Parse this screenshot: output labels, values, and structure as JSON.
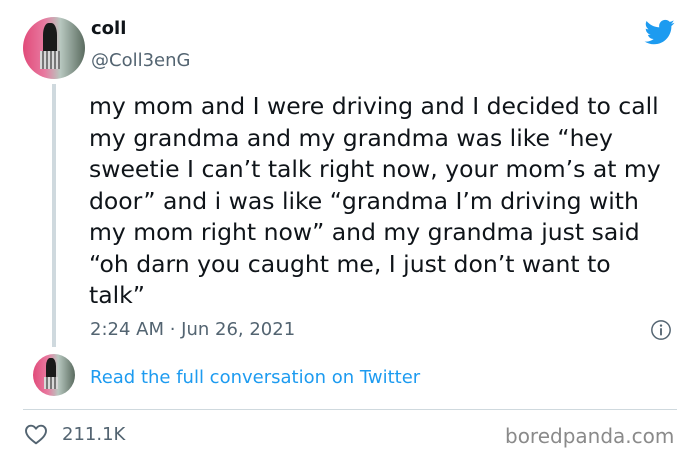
{
  "tweet": {
    "author": {
      "display_name": "coll",
      "handle": "@Coll3enG"
    },
    "text": "my mom and I were driving and I decided to call my grandma and my grandma was like “hey sweetie I can’t talk right now, your mom’s at my door” and i was like “grandma I’m driving with my mom right now” and my grandma just said “oh darn you caught me, I just don’t want to talk”",
    "timestamp": "2:24 AM · Jun 26, 2021",
    "read_more_label": "Read the full conversation on Twitter",
    "like_count": "211.1K"
  },
  "icons": {
    "brand": "twitter-bird-icon",
    "info": "info-icon",
    "like": "heart-icon"
  },
  "colors": {
    "brand_blue": "#1d9bf0",
    "secondary_text": "#536471",
    "primary_text": "#0f1419",
    "divider": "#cfd9de"
  },
  "watermark": "boredpanda.com"
}
